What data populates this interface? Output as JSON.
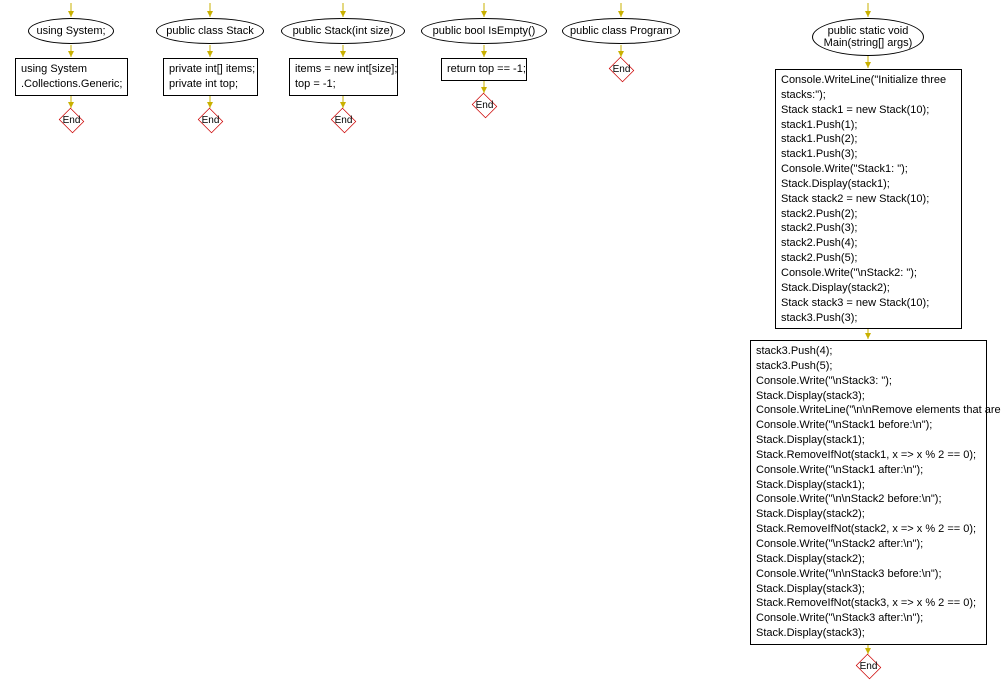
{
  "diagram": {
    "end_label": "End",
    "columns": [
      {
        "ellipse": "using System;",
        "rect": "using System\n.Collections.Generic;"
      },
      {
        "ellipse": "public class Stack",
        "rect": "private int[] items;\nprivate int top;"
      },
      {
        "ellipse": "public Stack(int size)",
        "rect": "items = new int[size];\ntop = -1;"
      },
      {
        "ellipse": "public bool IsEmpty()",
        "rect": "return top == -1;"
      },
      {
        "ellipse": "public class Program"
      }
    ],
    "main": {
      "ellipse_line1": "public static void",
      "ellipse_line2": "Main(string[] args)",
      "block1": "Console.WriteLine(\"Initialize three\nstacks:\");\nStack stack1 = new Stack(10);\nstack1.Push(1);\nstack1.Push(2);\nstack1.Push(3);\nConsole.Write(\"Stack1: \");\nStack.Display(stack1);\nStack stack2 = new Stack(10);\nstack2.Push(2);\nstack2.Push(3);\nstack2.Push(4);\nstack2.Push(5);\nConsole.Write(\"\\nStack2: \");\nStack.Display(stack2);\nStack stack3 = new Stack(10);\nstack3.Push(3);",
      "block2": "stack3.Push(4);\nstack3.Push(5);\nConsole.Write(\"\\nStack3: \");\nStack.Display(stack3);\nConsole.WriteLine(\"\\n\\nRemove elements that are odd:\");\nConsole.Write(\"\\nStack1 before:\\n\");\nStack.Display(stack1);\nStack.RemoveIfNot(stack1, x => x % 2 == 0);\nConsole.Write(\"\\nStack1 after:\\n\");\nStack.Display(stack1);\nConsole.Write(\"\\n\\nStack2 before:\\n\");\nStack.Display(stack2);\nStack.RemoveIfNot(stack2, x => x % 2 == 0);\nConsole.Write(\"\\nStack2 after:\\n\");\nStack.Display(stack2);\nConsole.Write(\"\\n\\nStack3 before:\\n\");\nStack.Display(stack3);\nStack.RemoveIfNot(stack3, x => x % 2 == 0);\nConsole.Write(\"\\nStack3 after:\\n\");\nStack.Display(stack3);"
    }
  }
}
